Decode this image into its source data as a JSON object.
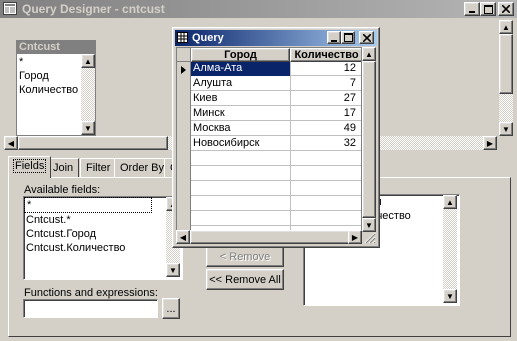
{
  "main_window": {
    "title": "Query Designer - cntcust"
  },
  "table_box": {
    "title": "Cntcust",
    "fields": [
      "*",
      "Город",
      "Количество"
    ]
  },
  "tabs": [
    {
      "label": "Fields"
    },
    {
      "label": "Join"
    },
    {
      "label": "Filter"
    },
    {
      "label": "Order By"
    },
    {
      "label": "G"
    }
  ],
  "fields_tab": {
    "available_label": "Available fields:",
    "available_items": [
      "*",
      "Cntcust.*",
      "Cntcust.Город",
      "Cntcust.Количество"
    ],
    "functions_label": "Functions and expressions:",
    "functions_value": "",
    "browse_label": "...",
    "remove_label": "< Remove",
    "remove_all_label": "<< Remove All",
    "selected_items_partial": [
      "ул",
      "личество"
    ]
  },
  "query_window": {
    "title": "Query",
    "columns": [
      "Город",
      "Количество"
    ],
    "rows": [
      {
        "city": "Алма-Ата",
        "count": "12"
      },
      {
        "city": "Алушта",
        "count": "7"
      },
      {
        "city": "Киев",
        "count": "27"
      },
      {
        "city": "Минск",
        "count": "17"
      },
      {
        "city": "Москва",
        "count": "49"
      },
      {
        "city": "Новосибирск",
        "count": "32"
      }
    ],
    "selected_row_index": 0
  },
  "colors": {
    "selection": "#0a246a",
    "face": "#d4d0c8"
  }
}
